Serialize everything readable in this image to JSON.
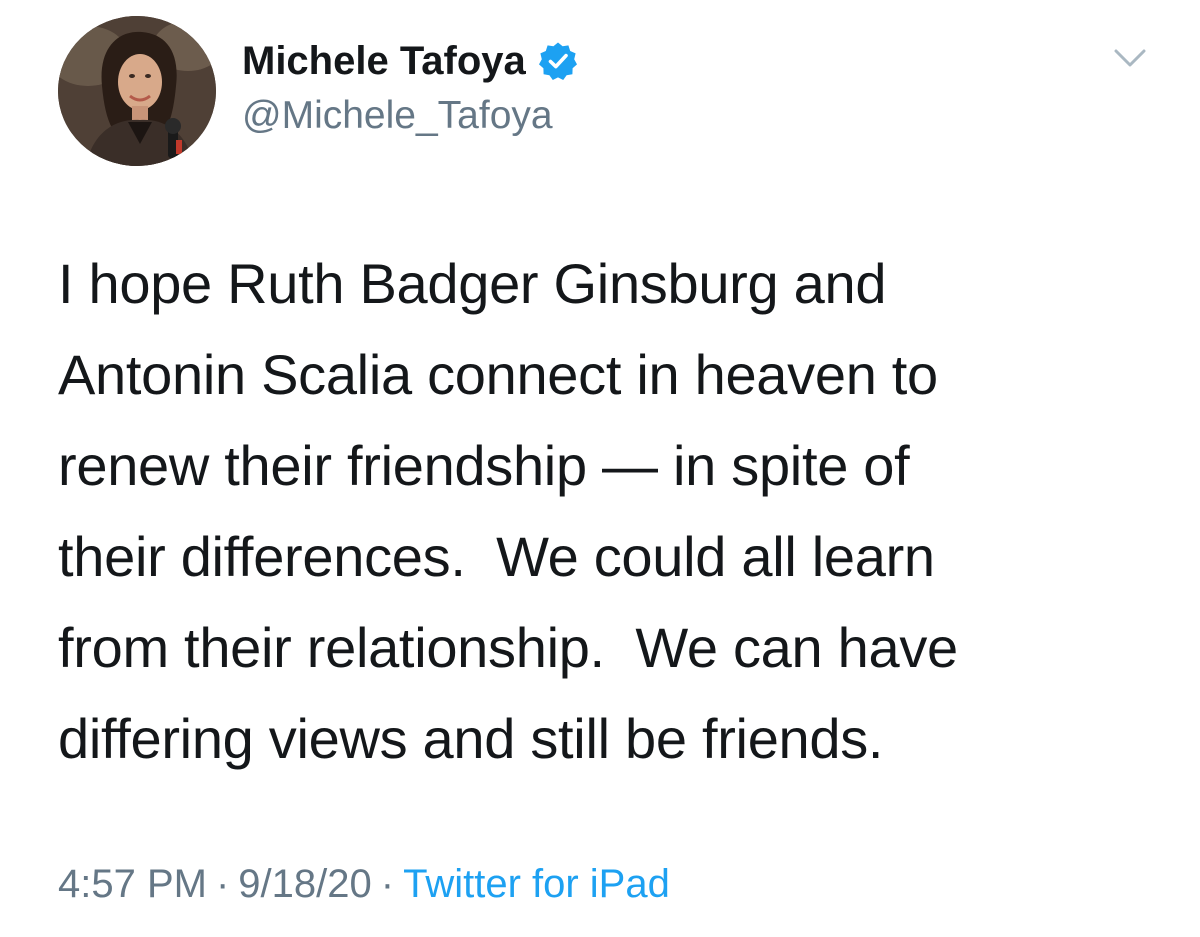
{
  "user": {
    "display_name": "Michele Tafoya",
    "handle": "@Michele_Tafoya",
    "verified": true,
    "avatar_icon": "profile-photo"
  },
  "tweet": {
    "text": "I hope Ruth Badger Ginsburg and\nAntonin Scalia connect in heaven to\nrenew their friendship — in spite of\ntheir differences.  We could all learn\nfrom their relationship.  We can have\ndiffering views and still be friends."
  },
  "meta": {
    "time": "4:57 PM",
    "separator": "·",
    "date": "9/18/20",
    "source": "Twitter for iPad"
  },
  "icons": {
    "verified": "verified-badge-icon",
    "menu": "chevron-down-icon"
  },
  "colors": {
    "text": "#14171a",
    "secondary": "#657786",
    "accent": "#1da1f2",
    "background": "#ffffff"
  }
}
